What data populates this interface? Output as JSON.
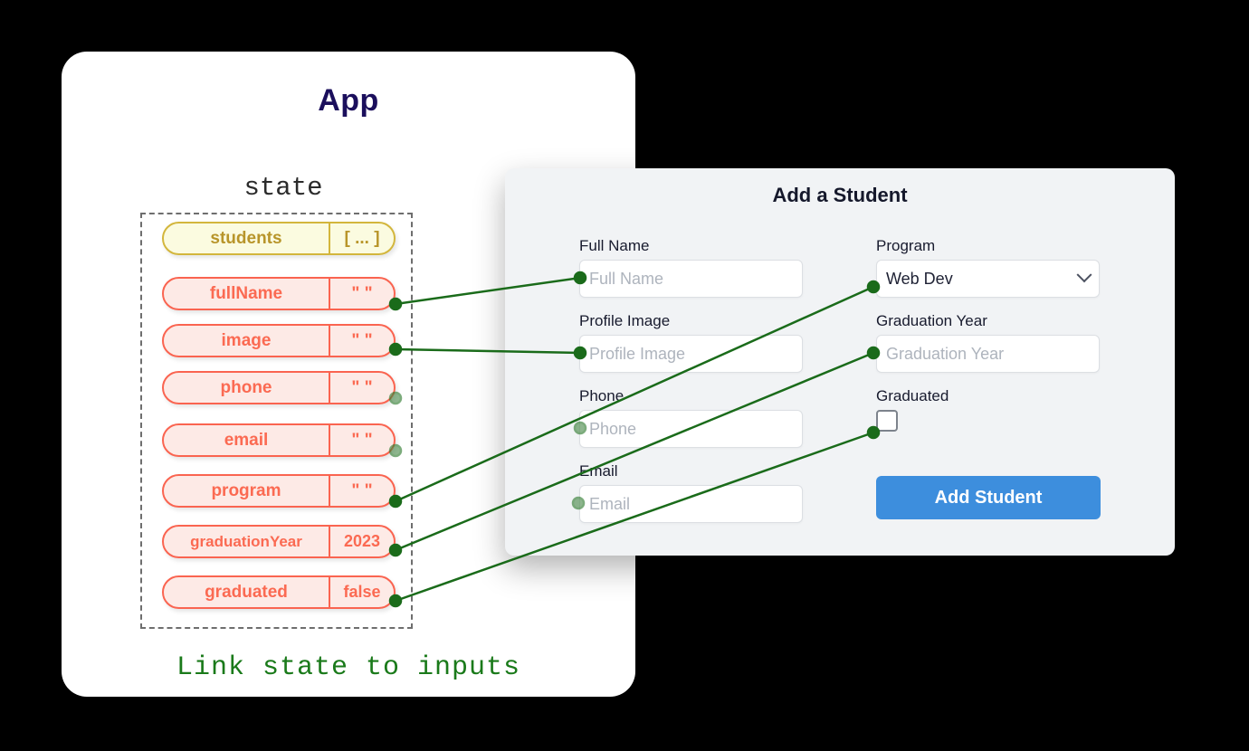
{
  "app": {
    "title": "App",
    "state_heading": "state",
    "caption": "Link state to inputs"
  },
  "state": {
    "entries": [
      {
        "key": "students",
        "value": "[ ... ]",
        "kind": "array"
      },
      {
        "key": "fullName",
        "value": "\" \"",
        "kind": "string"
      },
      {
        "key": "image",
        "value": "\" \"",
        "kind": "string"
      },
      {
        "key": "phone",
        "value": "\" \"",
        "kind": "string"
      },
      {
        "key": "email",
        "value": "\" \"",
        "kind": "string"
      },
      {
        "key": "program",
        "value": "\" \"",
        "kind": "string"
      },
      {
        "key": "graduationYear",
        "value": "2023",
        "kind": "number"
      },
      {
        "key": "graduated",
        "value": "false",
        "kind": "boolean"
      }
    ]
  },
  "form": {
    "title": "Add a Student",
    "fields": {
      "full_name": {
        "label": "Full Name",
        "placeholder": "Full Name"
      },
      "profile_image": {
        "label": "Profile Image",
        "placeholder": "Profile Image"
      },
      "phone": {
        "label": "Phone",
        "placeholder": "Phone"
      },
      "email": {
        "label": "Email",
        "placeholder": "Email"
      },
      "program": {
        "label": "Program",
        "value": "Web Dev"
      },
      "graduation_year": {
        "label": "Graduation Year",
        "placeholder": "Graduation Year"
      },
      "graduated": {
        "label": "Graduated",
        "checked": false
      }
    },
    "submit_label": "Add Student"
  },
  "colors": {
    "accent_button": "#3d8edd",
    "pill_string": "#fb6a52",
    "pill_array": "#b8952a",
    "link_line": "#1a6b1a",
    "caption": "#1a7a1a",
    "app_title": "#1b0f5c"
  }
}
